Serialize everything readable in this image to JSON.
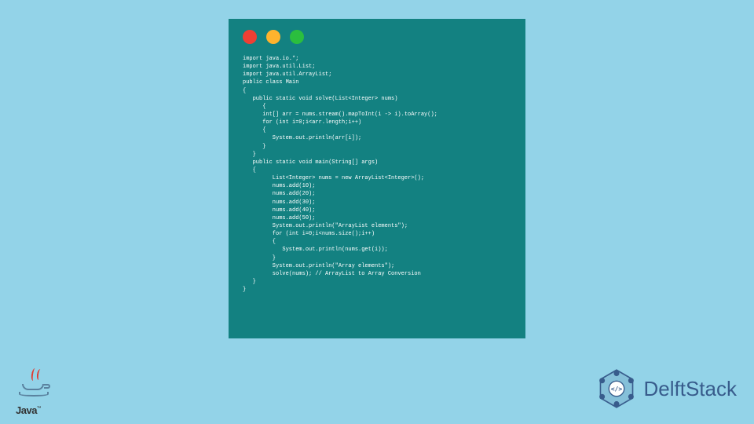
{
  "code": {
    "lines": [
      {
        "indent": 0,
        "text": "import java.io.*;"
      },
      {
        "indent": 0,
        "text": "import java.util.List;"
      },
      {
        "indent": 0,
        "text": "import java.util.ArrayList;"
      },
      {
        "indent": 0,
        "text": "public class Main"
      },
      {
        "indent": 0,
        "text": "{"
      },
      {
        "indent": 1,
        "text": "public static void solve(List<Integer> nums)"
      },
      {
        "indent": 2,
        "text": "{"
      },
      {
        "indent": 2,
        "text": "int[] arr = nums.stream().mapToInt(i -> i).toArray();"
      },
      {
        "indent": 2,
        "text": "for (int i=0;i<arr.length;i++)"
      },
      {
        "indent": 2,
        "text": "{"
      },
      {
        "indent": 3,
        "text": "System.out.println(arr[i]);"
      },
      {
        "indent": 2,
        "text": "}"
      },
      {
        "indent": 1,
        "text": "}"
      },
      {
        "indent": 1,
        "text": "public static void main(String[] args)"
      },
      {
        "indent": 1,
        "text": "{"
      },
      {
        "indent": 3,
        "text": "List<Integer> nums = new ArrayList<Integer>();"
      },
      {
        "indent": 3,
        "text": "nums.add(10);"
      },
      {
        "indent": 3,
        "text": "nums.add(20);"
      },
      {
        "indent": 3,
        "text": "nums.add(30);"
      },
      {
        "indent": 3,
        "text": "nums.add(40);"
      },
      {
        "indent": 3,
        "text": "nums.add(50);"
      },
      {
        "indent": 3,
        "text": "System.out.println(\"ArrayList elements\");"
      },
      {
        "indent": 3,
        "text": "for (int i=0;i<nums.size();i++)"
      },
      {
        "indent": 3,
        "text": "{"
      },
      {
        "indent": 4,
        "text": "System.out.println(nums.get(i));"
      },
      {
        "indent": 3,
        "text": "}"
      },
      {
        "indent": 3,
        "text": "System.out.println(\"Array elements\");"
      },
      {
        "indent": 3,
        "text": "solve(nums); // ArrayList to Array Conversion"
      },
      {
        "indent": 1,
        "text": "}"
      },
      {
        "indent": 0,
        "text": "}"
      }
    ]
  },
  "logos": {
    "java_text": "Java",
    "java_tm": "™",
    "delft_text": "DelftStack"
  },
  "colors": {
    "background": "#93d3e8",
    "code_bg": "#138181",
    "dot_red": "#ef3f34",
    "dot_yellow": "#ffb32d",
    "dot_green": "#2bbe3e",
    "delft_blue": "#385c8c"
  }
}
